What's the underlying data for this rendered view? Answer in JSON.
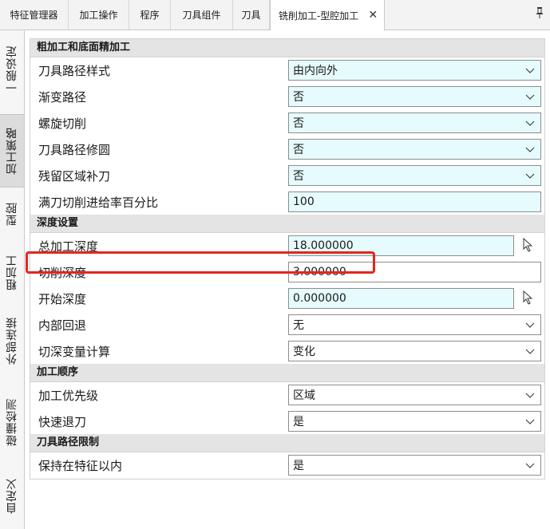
{
  "tabs": [
    {
      "label": "特征管理器"
    },
    {
      "label": "加工操作"
    },
    {
      "label": "程序"
    },
    {
      "label": "刀具组件"
    },
    {
      "label": "刀具"
    },
    {
      "label": "铣削加工-型腔加工"
    }
  ],
  "pin_icon": "pin-icon",
  "close_icon": "close-icon",
  "side_tabs": [
    {
      "label": "一般设定"
    },
    {
      "label": "加工策略"
    },
    {
      "label": "型腔"
    },
    {
      "label": "粗加工"
    },
    {
      "label": "外部连接"
    },
    {
      "label": "碰撞检测"
    },
    {
      "label": "自定义"
    }
  ],
  "sections": {
    "rough": {
      "title": "粗加工和底面精加工",
      "rows": [
        {
          "label": "刀具路径样式",
          "value": "由内向外"
        },
        {
          "label": "渐变路径",
          "value": "否"
        },
        {
          "label": "螺旋切削",
          "value": "否"
        },
        {
          "label": "刀具路径修圆",
          "value": "否"
        },
        {
          "label": "残留区域补刀",
          "value": "否"
        },
        {
          "label": "满刀切削进给率百分比",
          "value": "100"
        }
      ]
    },
    "depth": {
      "title": "深度设置",
      "rows": [
        {
          "label": "总加工深度",
          "value": "18.000000"
        },
        {
          "label": "切削深度",
          "value": "3.000000"
        },
        {
          "label": "开始深度",
          "value": "0.000000"
        },
        {
          "label": "内部回退",
          "value": "无"
        },
        {
          "label": "切深变量计算",
          "value": "变化"
        }
      ]
    },
    "order": {
      "title": "加工顺序",
      "rows": [
        {
          "label": "加工优先级",
          "value": "区域"
        },
        {
          "label": "快速退刀",
          "value": "是"
        }
      ]
    },
    "limit": {
      "title": "刀具路径限制",
      "rows": [
        {
          "label": "保持在特征以内",
          "value": "是"
        }
      ]
    }
  },
  "colors": {
    "field_bg": "#e6fbfd",
    "highlight": "#e3261f",
    "section_bg": "#e4e4e4"
  }
}
